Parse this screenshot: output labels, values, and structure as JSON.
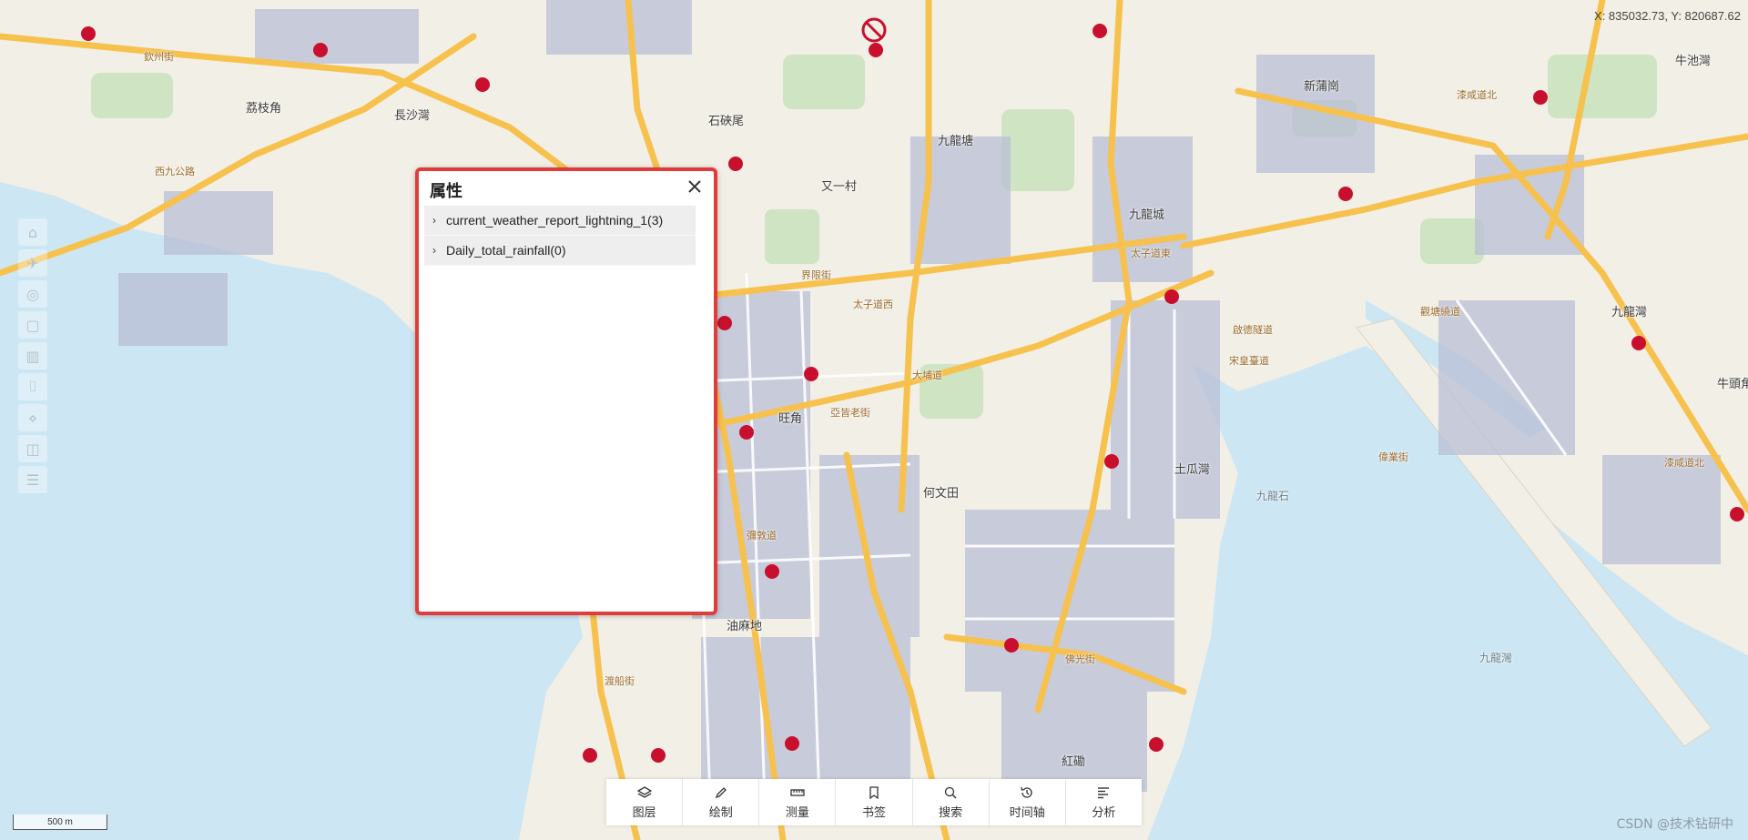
{
  "map": {
    "coordinates": "X: 835032.73, Y: 820687.62",
    "place_labels": [
      {
        "id": "lai-chi-kok",
        "text": "荔枝角",
        "kind": "place"
      },
      {
        "id": "cheung-sha-wan",
        "text": "長沙灣",
        "kind": "place"
      },
      {
        "id": "shek-kip-mei",
        "text": "石硤尾",
        "kind": "place"
      },
      {
        "id": "kowloon-tong",
        "text": "九龍塘",
        "kind": "place"
      },
      {
        "id": "yau-yat-chuen",
        "text": "又一村",
        "kind": "place"
      },
      {
        "id": "san-po-kong",
        "text": "新蒲崗",
        "kind": "place"
      },
      {
        "id": "ngau-chi-wan",
        "text": "牛池灣",
        "kind": "place"
      },
      {
        "id": "kowloon-city",
        "text": "九龍城",
        "kind": "place"
      },
      {
        "id": "kowloon-bay",
        "text": "九龍灣",
        "kind": "place"
      },
      {
        "id": "mong-kok",
        "text": "旺角",
        "kind": "place"
      },
      {
        "id": "ho-man-tin",
        "text": "何文田",
        "kind": "place"
      },
      {
        "id": "to-kwa-wan",
        "text": "土瓜灣",
        "kind": "place"
      },
      {
        "id": "yau-ma-tei",
        "text": "油麻地",
        "kind": "place"
      },
      {
        "id": "hung-hom",
        "text": "紅磡",
        "kind": "place"
      },
      {
        "id": "ngau-tau-kok",
        "text": "牛頭角",
        "kind": "place"
      },
      {
        "id": "kowloon-rock",
        "text": "九龍石",
        "kind": "water"
      },
      {
        "id": "kowloon-bay-water",
        "text": "九龍灣",
        "kind": "water"
      },
      {
        "id": "boundary-street",
        "text": "界限街",
        "kind": "road"
      },
      {
        "id": "prince-edward-road-west",
        "text": "太子道西",
        "kind": "road"
      },
      {
        "id": "prince-edward-road-east",
        "text": "太子道東",
        "kind": "road"
      },
      {
        "id": "argyle-street",
        "text": "亞皆老街",
        "kind": "road"
      },
      {
        "id": "kai-tak-tunnel",
        "text": "啟德隧道",
        "kind": "road"
      },
      {
        "id": "tai-po-road",
        "text": "大埔道",
        "kind": "road"
      },
      {
        "id": "chatham-road",
        "text": "漆咸道北",
        "kind": "road"
      },
      {
        "id": "wai-yip-street",
        "text": "偉業街",
        "kind": "road"
      },
      {
        "id": "tsing-yi-road",
        "text": "西九公路",
        "kind": "road"
      },
      {
        "id": "yen-chow-street",
        "text": "欽州街",
        "kind": "road"
      },
      {
        "id": "sheung-yee-road",
        "text": "宋皇臺道",
        "kind": "road"
      },
      {
        "id": "chatham-road-2",
        "text": "漆咸道北",
        "kind": "road"
      },
      {
        "id": "ferry-street",
        "text": "渡船街",
        "kind": "road"
      },
      {
        "id": "nathan-road",
        "text": "彌敦道",
        "kind": "road"
      },
      {
        "id": "kwun-tong-bypass",
        "text": "觀塘繞道",
        "kind": "road"
      },
      {
        "id": "hung-hom-road",
        "text": "佛光街",
        "kind": "road"
      }
    ],
    "scale_label": "500 m",
    "watermark": "CSDN @技术钻研中"
  },
  "side_tools": [
    {
      "id": "home",
      "icon": "home-icon",
      "glyph": "⌂"
    },
    {
      "id": "fly",
      "icon": "plane-icon",
      "glyph": "✈"
    },
    {
      "id": "globe",
      "icon": "globe-icon",
      "glyph": "◎"
    },
    {
      "id": "box",
      "icon": "square-icon",
      "glyph": "▢"
    },
    {
      "id": "building",
      "icon": "building-icon",
      "glyph": "▥"
    },
    {
      "id": "frame",
      "icon": "frame-icon",
      "glyph": "⌷"
    },
    {
      "id": "compass",
      "icon": "compass-icon",
      "glyph": "⋄"
    },
    {
      "id": "split",
      "icon": "split-view-icon",
      "glyph": "◫"
    },
    {
      "id": "list",
      "icon": "list-icon",
      "glyph": "☰"
    }
  ],
  "attributes_panel": {
    "title": "属性",
    "rows": [
      {
        "label": "current_weather_report_lightning_1(3)"
      },
      {
        "label": "Daily_total_rainfall(0)"
      }
    ]
  },
  "toolbar": {
    "items": [
      {
        "id": "layers",
        "label": "图层",
        "icon": "layers-icon"
      },
      {
        "id": "draw",
        "label": "绘制",
        "icon": "pencil-icon"
      },
      {
        "id": "measure",
        "label": "测量",
        "icon": "ruler-icon"
      },
      {
        "id": "bookmark",
        "label": "书签",
        "icon": "bookmark-icon"
      },
      {
        "id": "search",
        "label": "搜索",
        "icon": "search-icon"
      },
      {
        "id": "timeline",
        "label": "时间轴",
        "icon": "history-icon"
      },
      {
        "id": "analysis",
        "label": "分析",
        "icon": "align-left-icon"
      }
    ]
  },
  "colors": {
    "land": "#f2efe6",
    "water": "#cce6f4",
    "major_road": "#f7c14e",
    "minor_road": "#ffffff",
    "urban_block": "#b9bfd6",
    "park": "#cfe4c3",
    "mtr": "#c8102e",
    "panel_border": "#e03c3c"
  }
}
